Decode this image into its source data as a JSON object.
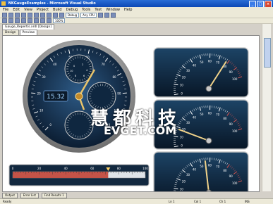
{
  "window": {
    "title": "NKGaugeExamples - Microsoft Visual Studio",
    "minimize": "_",
    "maximize": "□",
    "close": "×"
  },
  "menu": [
    "File",
    "Edit",
    "View",
    "Project",
    "Build",
    "Debug",
    "Tools",
    "Test",
    "Window",
    "Help"
  ],
  "toolbar": {
    "config": "Debug",
    "platform": "Any CPU",
    "zoom": "100%"
  },
  "document_tab": "Gauge_Repertis.xrdl [Design]",
  "designer_tabs": [
    "Design",
    "Preview"
  ],
  "main_gauge": {
    "digital_value": "15.32",
    "scale_labels": [
      "0",
      "10",
      "20",
      "30",
      "40",
      "50",
      "60",
      "70",
      "80",
      "90",
      "100",
      "110"
    ],
    "subdial_labels": [
      "0",
      "2",
      "4",
      "6",
      "8",
      "10"
    ]
  },
  "linear_gauge": {
    "labels": [
      "0",
      "20",
      "40",
      "60",
      "80",
      "100"
    ],
    "value": 72
  },
  "right_gauges": [
    {
      "labels": [
        "0",
        "10",
        "20",
        "30",
        "40",
        "50",
        "60",
        "70",
        "80",
        "90",
        "100"
      ],
      "value": 78
    },
    {
      "labels": [
        "0",
        "10",
        "20",
        "30",
        "40",
        "50",
        "60",
        "70",
        "80",
        "90",
        "100"
      ],
      "value": 18
    },
    {
      "labels": [
        "0",
        "10",
        "20",
        "30",
        "40",
        "50",
        "60",
        "70",
        "80",
        "90",
        "100"
      ],
      "value": 55
    }
  ],
  "watermark": {
    "main": "慧都科技",
    "sub": "EVGET.COM"
  },
  "bottom_tabs": [
    "Output",
    "Error List",
    "Find Results 1"
  ],
  "status": {
    "ready": "Ready",
    "ln": "Ln 1",
    "col": "Col 1",
    "ch": "Ch 1",
    "mode": "INS"
  },
  "colors": {
    "title_bar": "#0b47b5",
    "gauge_face": "#163a5c",
    "needle": "#e9c46a",
    "redline": "#c0392b"
  }
}
